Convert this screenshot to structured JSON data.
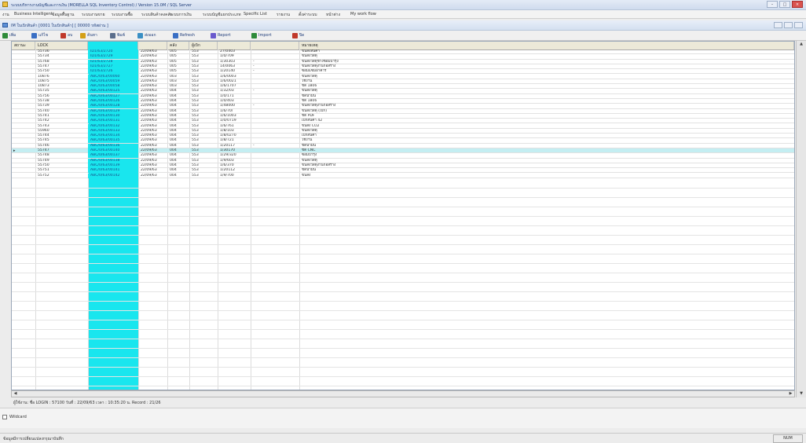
{
  "window": {
    "title": "ระบบบริหารงานบัญชีและการเงิน (MORELLA SQL Inventory Control) / Version 15.0M / SQL Server",
    "buttons": [
      "–",
      "□",
      "×"
    ]
  },
  "menu": [
    "งาน",
    "Business Intelligent",
    "ข้อมูลพื้นฐาน",
    "ระบบงานขาย",
    "ระบบงานซื้อ",
    "ระบบสินค้าคงคลัง",
    "ระบบการเงิน",
    "ระบบบัญชีแยกประเภท",
    "Specific List",
    "รายงาน",
    "ตั้งค่าระบบ",
    "หน้าต่าง",
    "My work flow"
  ],
  "subwindow": {
    "title": "IM ใบเบิกสินค้า [0001 ใบเบิกสินค้า] [ 00000 รหัสผ่าน ]"
  },
  "toolbar": [
    {
      "label": "เพิ่ม",
      "icon": "add-icon",
      "color": "#2e8b3a"
    },
    {
      "label": "แก้ไข",
      "icon": "edit-icon",
      "color": "#3a6fc4"
    },
    {
      "label": "ลบ",
      "icon": "delete-icon",
      "color": "#c0392b"
    },
    {
      "label": "ค้นหา",
      "icon": "find-icon",
      "color": "#d4a017"
    },
    {
      "label": "พิมพ์",
      "icon": "print-icon",
      "color": "#5a6e8c"
    },
    {
      "label": "ส่งออก",
      "icon": "export-icon",
      "color": "#3a8fc4"
    },
    {
      "label": "Refresh",
      "icon": "refresh-icon",
      "color": "#3a6fc4"
    },
    {
      "label": "Report",
      "icon": "report-icon",
      "color": "#6a5acd"
    },
    {
      "label": "Import",
      "icon": "import-icon",
      "color": "#2e8b3a"
    },
    {
      "label": "ปิด",
      "icon": "close-icon",
      "color": "#c0392b"
    }
  ],
  "columns": [
    {
      "label": "สถานะ",
      "key": "status"
    },
    {
      "label": "LOCK",
      "key": "lock"
    },
    {
      "label": "",
      "key": "docno"
    },
    {
      "label": "",
      "key": "date"
    },
    {
      "label": "คลัง",
      "key": "wh"
    },
    {
      "label": "ผู้เบิก",
      "key": "user"
    },
    {
      "label": "",
      "key": "amount"
    },
    {
      "label": "",
      "key": "flag"
    },
    {
      "label": "หมายเหตุ",
      "key": "note"
    }
  ],
  "rows": [
    {
      "id": "55736",
      "docno": "ID1/63/2720",
      "date": "22/09/63",
      "wh": "005",
      "user": "553",
      "amount": "27/0403",
      "flag": "",
      "note": "ขนส่งสินค้า"
    },
    {
      "id": "55734",
      "docno": "ID1/63/2729",
      "date": "22/09/63",
      "wh": "005",
      "user": "553",
      "amount": "1/0/709",
      "flag": "",
      "note": "ขนส่งวัสดุ"
    },
    {
      "id": "55768",
      "docno": "ID1/63/2728",
      "date": "22/09/63",
      "wh": "005",
      "user": "553",
      "amount": "1/30303",
      "flag": "-",
      "note": "ขนส่งวัสดุช่างซ่อมบำรุง"
    },
    {
      "id": "55747",
      "docno": "ID1/63/2727",
      "date": "22/09/63",
      "wh": "005",
      "user": "553",
      "amount": "14/0063",
      "flag": "-",
      "note": "ขนส่งวัสดุงานก่อสร้าง"
    },
    {
      "id": "55750",
      "docno": "ID1/63/2726",
      "date": "22/09/63",
      "wh": "005",
      "user": "553",
      "amount": "1/20140",
      "flag": "-",
      "note": "ซ่อมแซมอาคาร"
    },
    {
      "id": "10876",
      "docno": "ABC/0/63/00060",
      "date": "22/09/63",
      "wh": "003",
      "user": "553",
      "amount": "1/6/0003",
      "flag": "",
      "note": "ขนส่งวัสดุ"
    },
    {
      "id": "10875",
      "docno": "ABC/0/63/00059",
      "date": "22/09/63",
      "wh": "003",
      "user": "553",
      "amount": "1/6/0021",
      "flag": "",
      "note": "ใช้งาน"
    },
    {
      "id": "10873",
      "docno": "ABC/0/63/00058",
      "date": "22/09/63",
      "wh": "003",
      "user": "553",
      "amount": "1/6/1707",
      "flag": "",
      "note": "ขัด 1806"
    },
    {
      "id": "55735",
      "docno": "ABC/0/63/00125",
      "date": "22/09/63",
      "wh": "004",
      "user": "553",
      "amount": "1/32/03",
      "flag": "-",
      "note": "ขนส่งวัสดุ"
    },
    {
      "id": "55756",
      "docno": "ABC/0/63/00127",
      "date": "22/09/63",
      "wh": "004",
      "user": "553",
      "amount": "1/0/171",
      "flag": "",
      "note": "ขัดน้ำมัน"
    },
    {
      "id": "55738",
      "docno": "ABC/0/63/00126",
      "date": "22/09/63",
      "wh": "004",
      "user": "553",
      "amount": "1/0/403",
      "flag": "",
      "note": "ขัด 1806"
    },
    {
      "id": "55739",
      "docno": "ABC/0/63/00128",
      "date": "22/09/63",
      "wh": "004",
      "user": "553",
      "amount": "1/48000",
      "flag": "-",
      "note": "ขนส่งวัสดุงานก่อสร้าง"
    },
    {
      "id": "55740",
      "docno": "ABC/0/63/00129",
      "date": "22/09/63",
      "wh": "004",
      "user": "553",
      "amount": "1/6/70/",
      "flag": "",
      "note": "ขนส่งวัสดุ (เบิก)"
    },
    {
      "id": "55741",
      "docno": "ABC/0/63/00130",
      "date": "22/09/63",
      "wh": "004",
      "user": "553",
      "amount": "1/6/1003",
      "flag": "",
      "note": "ขัด PDF"
    },
    {
      "id": "55742",
      "docno": "ABC/0/63/00131",
      "date": "22/09/63",
      "wh": "004",
      "user": "553",
      "amount": "1/0/0719",
      "flag": "",
      "note": "เบิกสินค้า 42"
    },
    {
      "id": "55743",
      "docno": "ABC/0/63/00132",
      "date": "22/09/63",
      "wh": "004",
      "user": "553",
      "amount": "1/6/761",
      "flag": "",
      "note": "ขนส่ง CO2"
    },
    {
      "id": "55960",
      "docno": "ABC/0/63/00133",
      "date": "22/09/63",
      "wh": "004",
      "user": "553",
      "amount": "1/8/103",
      "flag": "",
      "note": "ขนส่งวัสดุ"
    },
    {
      "id": "55744",
      "docno": "ABC/0/63/00134",
      "date": "22/09/63",
      "wh": "004",
      "user": "553",
      "amount": "1/8/0270",
      "flag": "",
      "note": "เบิกสินค้า"
    },
    {
      "id": "55745",
      "docno": "ABC/0/63/00135",
      "date": "22/09/63",
      "wh": "004",
      "user": "553",
      "amount": "1/8/721",
      "flag": "",
      "note": "ใช้งาน"
    },
    {
      "id": "55746",
      "docno": "ABC/0/63/00136",
      "date": "22/09/63",
      "wh": "004",
      "user": "553",
      "amount": "1/20117",
      "flag": "-",
      "note": "ขัดน้ำมัน"
    },
    {
      "id": "55747",
      "docno": "ABC/0/63/00140",
      "date": "22/09/63",
      "wh": "004",
      "user": "553",
      "amount": "1/30170",
      "flag": "",
      "note": "ขัด CNC"
    },
    {
      "id": "55748",
      "docno": "ABC/0/63/00137",
      "date": "22/09/63",
      "wh": "004",
      "user": "553",
      "amount": "1/29/320",
      "flag": "",
      "note": "ซ่อมบำรุง"
    },
    {
      "id": "55749",
      "docno": "ABC/0/63/00138",
      "date": "22/09/63",
      "wh": "004",
      "user": "553",
      "amount": "1/9/603",
      "flag": "",
      "note": "ขนส่งวัสดุ"
    },
    {
      "id": "55750",
      "docno": "ABC/0/63/00139",
      "date": "22/09/63",
      "wh": "004",
      "user": "553",
      "amount": "1/6/370",
      "flag": "",
      "note": "ขนส่งวัสดุงานก่อสร้าง"
    },
    {
      "id": "55751",
      "docno": "ABC/0/63/00141",
      "date": "22/09/63",
      "wh": "004",
      "user": "553",
      "amount": "1/20112",
      "flag": "",
      "note": "ขัดน้ำมัน"
    },
    {
      "id": "55752",
      "docno": "ABC/0/63/00142",
      "date": "22/09/63",
      "wh": "004",
      "user": "553",
      "amount": "1/9/700",
      "flag": "",
      "note": "ขนส่ง"
    }
  ],
  "selected_row_index": 20,
  "status_line": "ผู้ใช้งาน: ชื่อ LOGIN : 57100 วันที่ : 22/09/63 เวลา : 10:35:20 น.  Record : 21/26",
  "checkbox_label": "Wildcard",
  "statusbar": {
    "text": "ข้อมูลมีการเปลี่ยนแปลงกรุณาบันทึก",
    "right": "NUM"
  },
  "colors": {
    "highlight_column": "#19e6ee",
    "selected_row": "#c4eef2"
  }
}
